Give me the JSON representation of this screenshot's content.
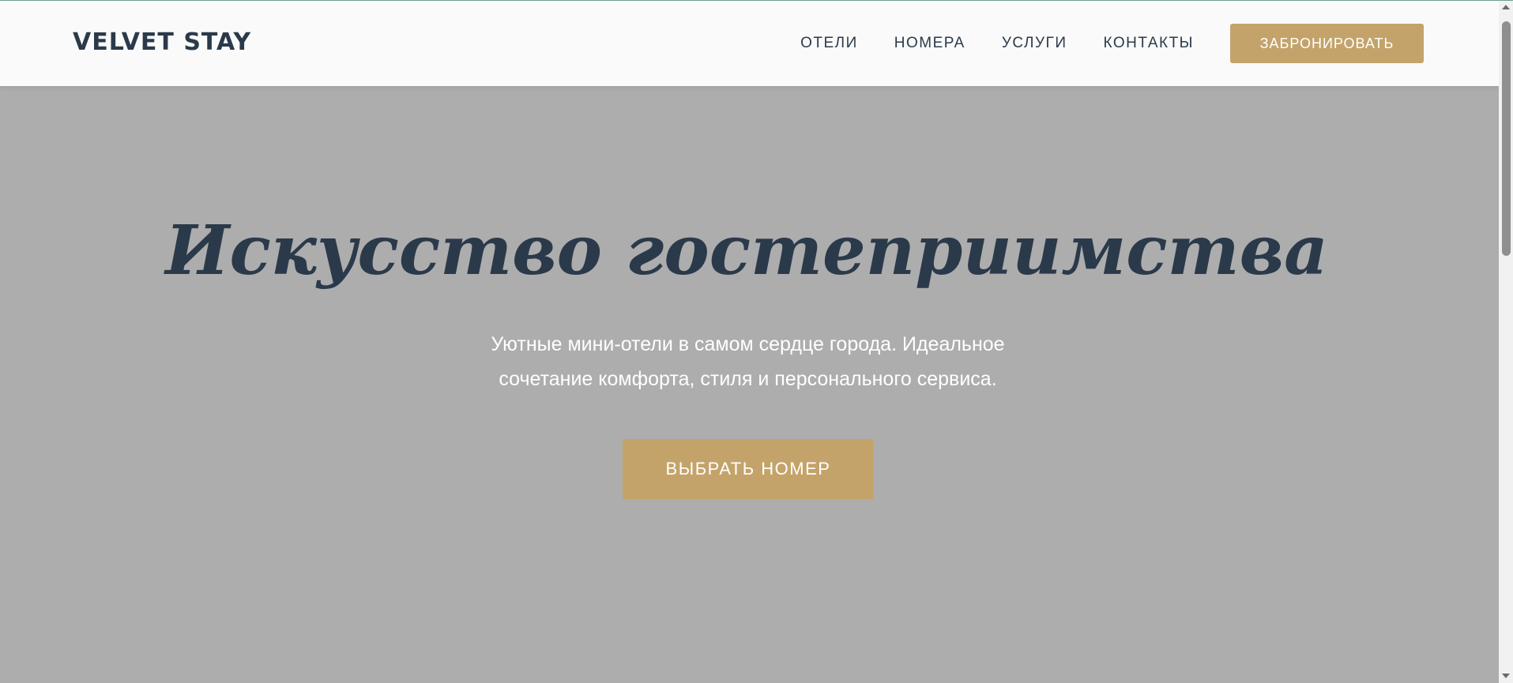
{
  "header": {
    "logo": "VELVET STAY",
    "nav": [
      {
        "label": "ОТЕЛИ"
      },
      {
        "label": "НОМЕРА"
      },
      {
        "label": "УСЛУГИ"
      },
      {
        "label": "КОНТАКТЫ"
      }
    ],
    "book_button": "ЗАБРОНИРОВАТЬ"
  },
  "hero": {
    "title": "Искусство гостеприимства",
    "subtitle_line1": "Уютные мини-отели в самом сердце города. Идеальное",
    "subtitle_line2": "сочетание комфорта, стиля и персонального сервиса.",
    "cta_button": "ВЫБРАТЬ НОМЕР"
  },
  "colors": {
    "accent": "#c4a36a",
    "dark_text": "#2b3a4a",
    "hero_background": "#adadad",
    "header_background": "#fafafa"
  }
}
